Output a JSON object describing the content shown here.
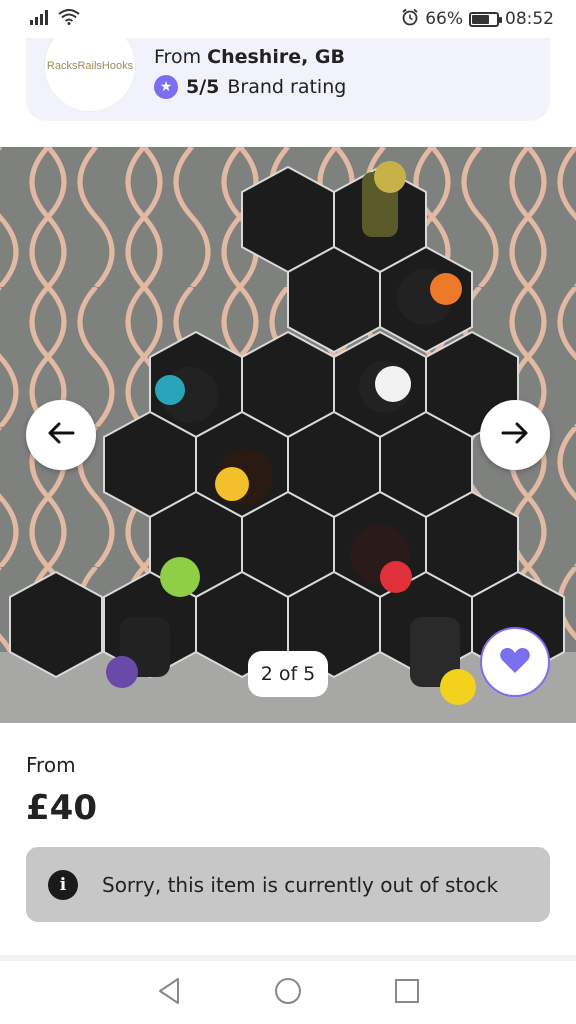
{
  "status_bar": {
    "battery": "66%",
    "battery_level": 0.66,
    "time": "08:52",
    "icons": [
      "signal-icon",
      "wifi-icon",
      "alarm-icon",
      "battery-icon"
    ]
  },
  "seller": {
    "logo_text": "RacksRailsHooks",
    "from_prefix": "From",
    "location": "Cheshire, GB",
    "rating": "5/5",
    "rating_label": "Brand rating",
    "star_color": "#7b6ef0"
  },
  "gallery": {
    "counter": "2 of 5",
    "prev_icon": "arrow-left-icon",
    "next_icon": "arrow-right-icon",
    "favorite_icon": "heart-icon",
    "accent": "#7b6ef0"
  },
  "price": {
    "label": "From",
    "value": "£40"
  },
  "stock_notice": {
    "icon": "info-icon",
    "text": "Sorry, this item is currently out of stock"
  },
  "nav_bar": {
    "icons": [
      "back-triangle-icon",
      "home-circle-icon",
      "recents-square-icon"
    ]
  }
}
